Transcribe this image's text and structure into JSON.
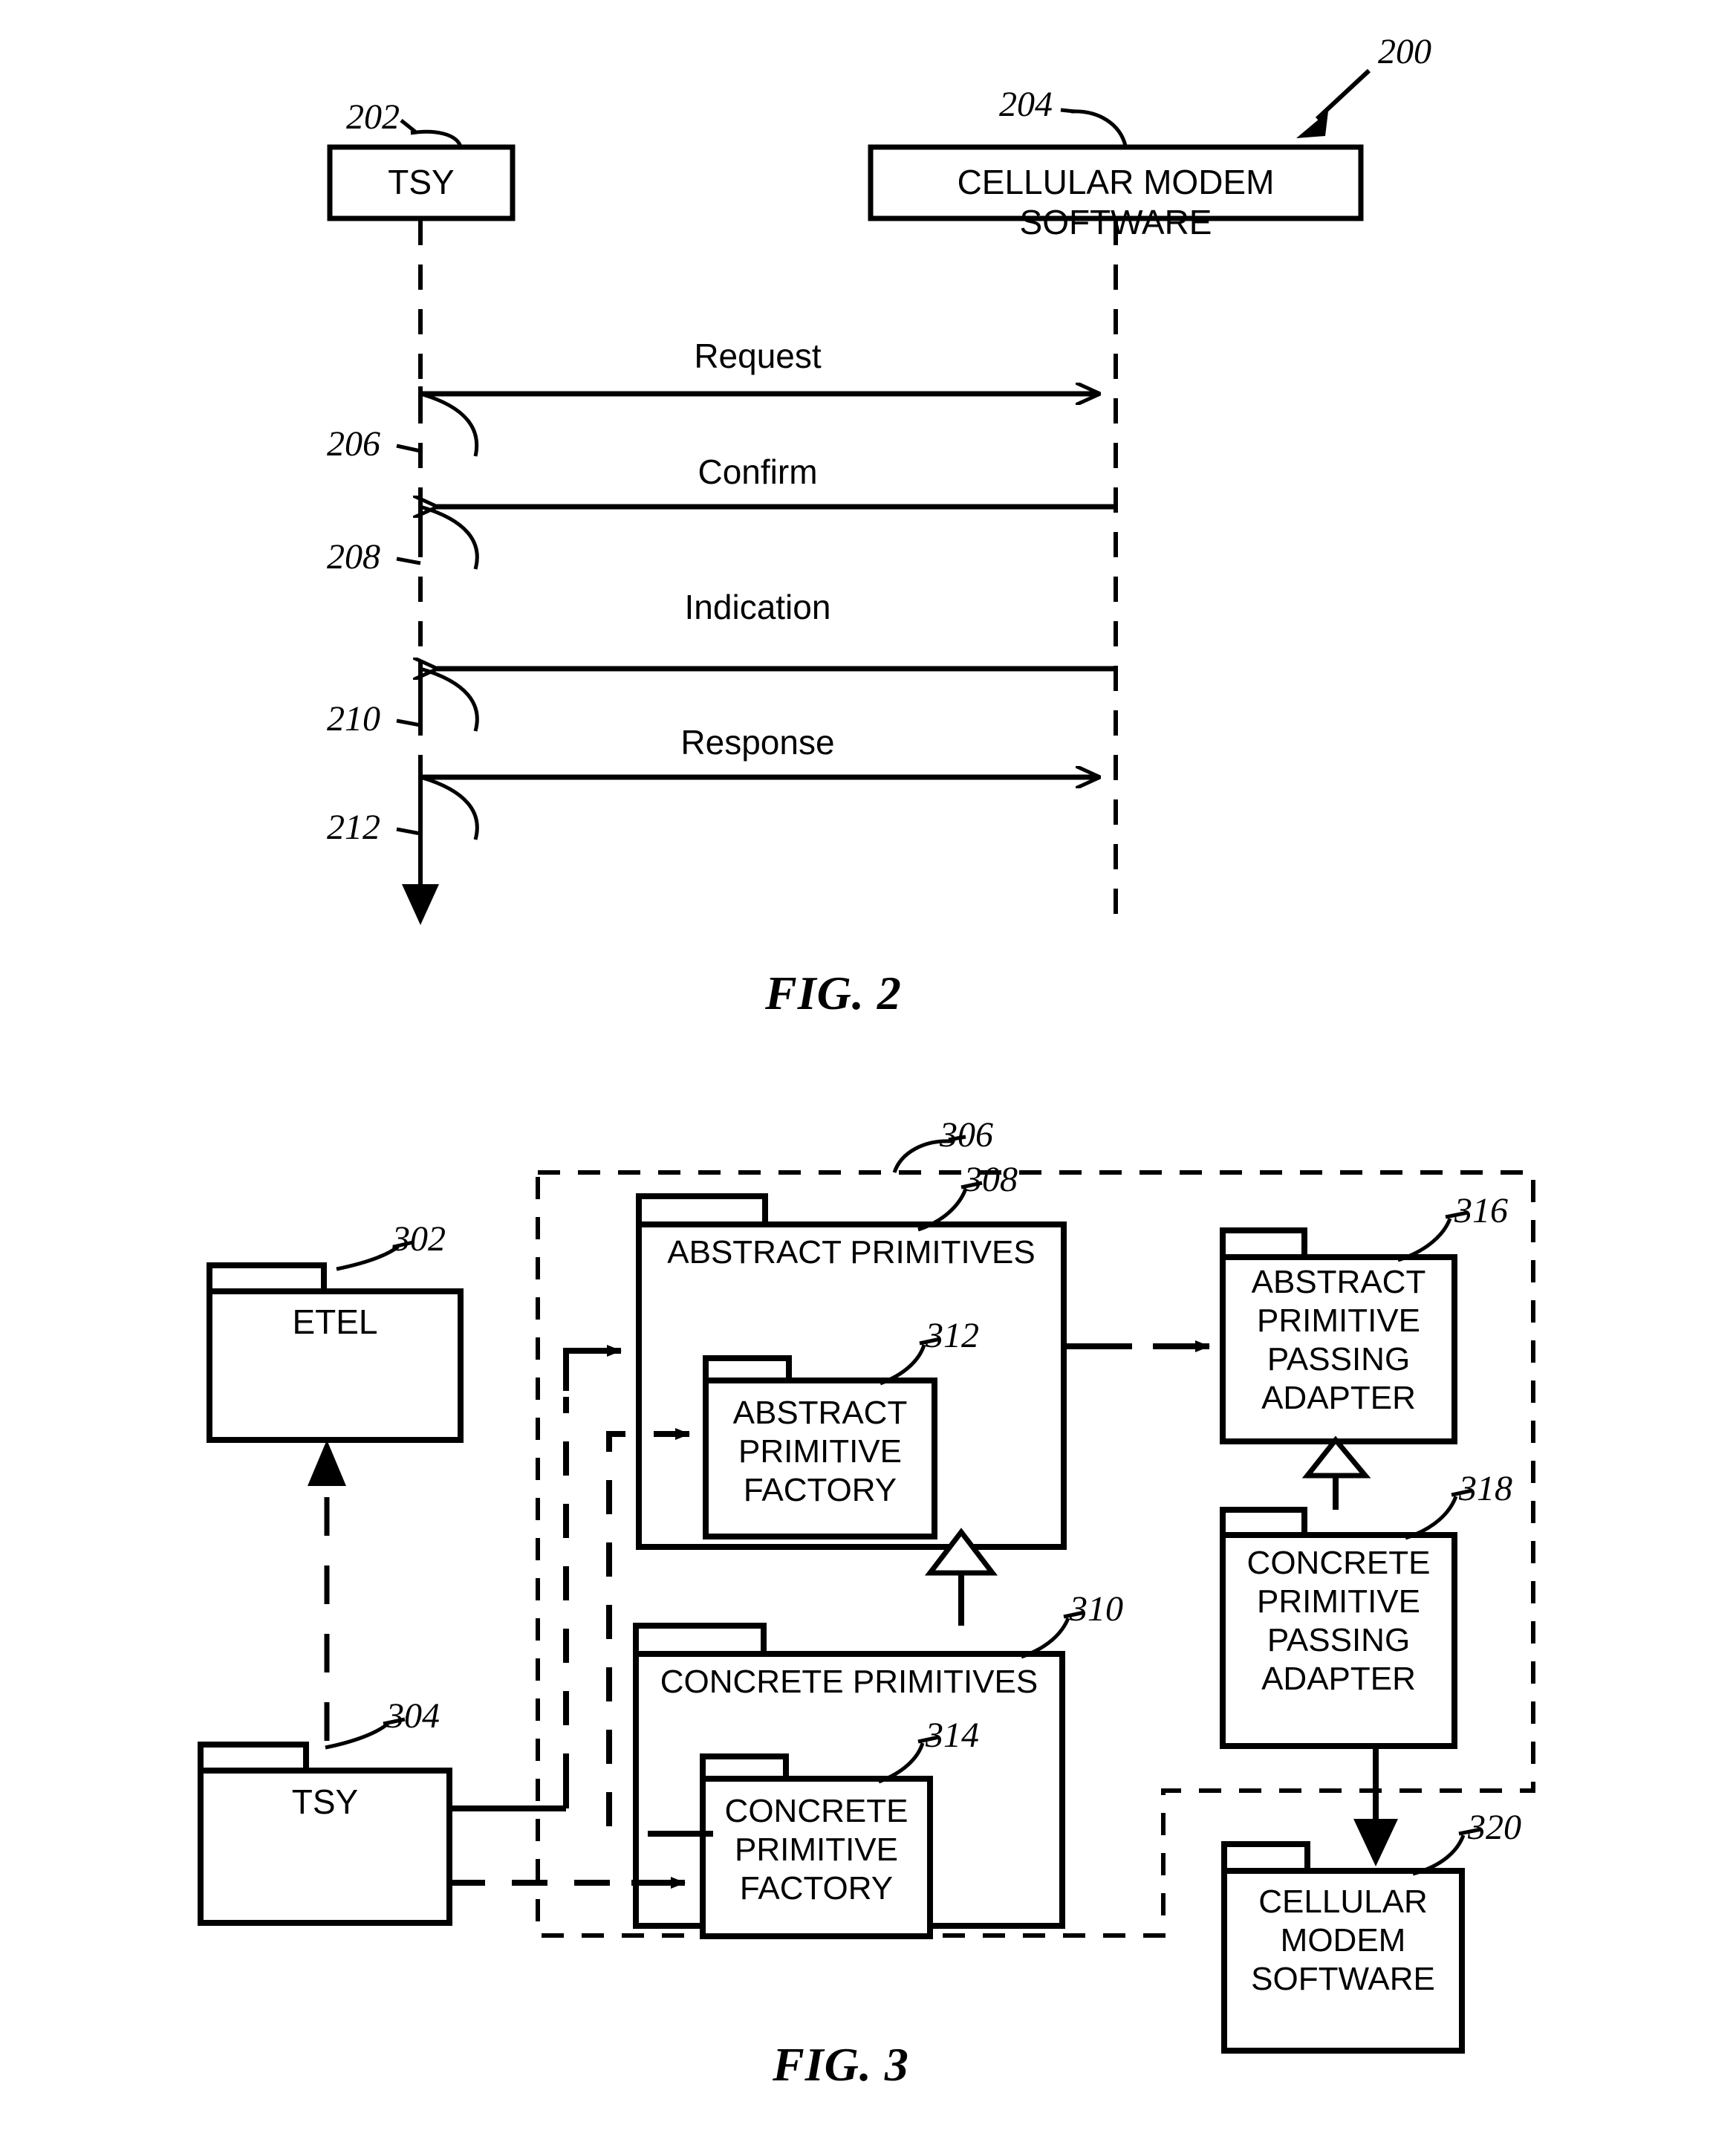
{
  "figure2": {
    "caption": "FIG. 2",
    "diagram_ref": "200",
    "participants": [
      {
        "ref": "202",
        "label": "TSY"
      },
      {
        "ref": "204",
        "label": "CELLULAR MODEM SOFTWARE"
      }
    ],
    "messages": [
      {
        "ref": "206",
        "label": "Request",
        "direction": "left-to-right"
      },
      {
        "ref": "208",
        "label": "Confirm",
        "direction": "right-to-left"
      },
      {
        "ref": "210",
        "label": "Indication",
        "direction": "right-to-left"
      },
      {
        "ref": "212",
        "label": "Response",
        "direction": "left-to-right"
      }
    ]
  },
  "figure3": {
    "caption": "FIG. 3",
    "boundary_ref": "306",
    "packages": [
      {
        "ref": "302",
        "label": "ETEL"
      },
      {
        "ref": "304",
        "label": "TSY"
      },
      {
        "ref": "308",
        "label": "ABSTRACT PRIMITIVES"
      },
      {
        "ref": "310",
        "label": "CONCRETE PRIMITIVES"
      },
      {
        "ref": "312",
        "label": "ABSTRACT\nPRIMITIVE\nFACTORY"
      },
      {
        "ref": "314",
        "label": "CONCRETE\nPRIMITIVE\nFACTORY"
      },
      {
        "ref": "316",
        "label": "ABSTRACT\nPRIMITIVE\nPASSING\nADAPTER"
      },
      {
        "ref": "318",
        "label": "CONCRETE\nPRIMITIVE\nPASSING\nADAPTER"
      },
      {
        "ref": "320",
        "label": "CELLULAR\nMODEM\nSOFTWARE"
      }
    ]
  },
  "colors": {
    "ink": "#000000",
    "paper": "#ffffff"
  }
}
